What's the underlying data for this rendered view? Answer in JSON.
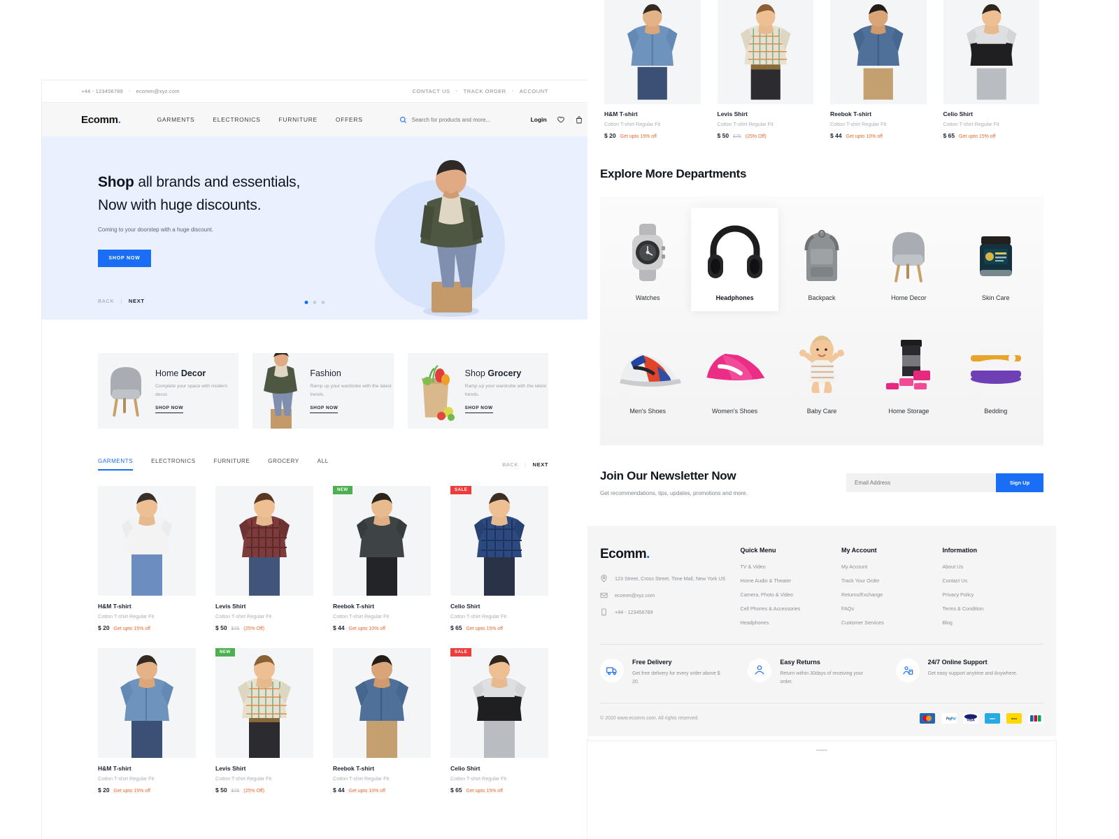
{
  "topbar": {
    "phone": "+44 - 123456789",
    "email": "ecomm@xyz.com",
    "links": [
      "CONTACT US",
      "TRACK ORDER",
      "ACCOUNT"
    ],
    "separator": "›"
  },
  "nav": {
    "brand": "Ecomm",
    "brand_dot": ".",
    "links": [
      "GARMENTS",
      "ELECTRONICS",
      "FURNITURE",
      "OFFERS"
    ],
    "search_placeholder": "Search for products and more...",
    "login": "Login",
    "accent": "#1a6ef5"
  },
  "hero": {
    "title_bold": "Shop",
    "title_rest": " all brands and essentials, Now with huge discounts.",
    "subtitle": "Coming to your doorstep with a huge discount.",
    "cta": "SHOP NOW",
    "back": "BACK",
    "divider": "|",
    "next": "NEXT",
    "slide_count": 3,
    "active_slide": 1
  },
  "category_cards": [
    {
      "title_pre": "Home ",
      "title_bold": "Decor",
      "desc": "Complete your space with modern decor.",
      "cta": "SHOP NOW",
      "icon": "chair-icon"
    },
    {
      "title_pre": "",
      "title_bold": "Fashion",
      "desc": "Ramp up your wardrobe with the latest trends.",
      "cta": "SHOP NOW",
      "icon": "fashion-model-icon"
    },
    {
      "title_pre": "Shop ",
      "title_bold": "Grocery",
      "desc": "Ramp up your wardrobe with the latest trends.",
      "cta": "SHOP NOW",
      "icon": "grocery-bag-icon"
    }
  ],
  "product_tabs": {
    "items": [
      "GARMENTS",
      "ELECTRONICS",
      "FURNITURE",
      "GROCERY",
      "ALL"
    ],
    "active": "GARMENTS",
    "back": "BACK",
    "divider": "|",
    "next": "NEXT"
  },
  "products_row1": [
    {
      "name": "H&M T-shirt",
      "desc": "Cotton T-shirt Regular Fit",
      "price": "$ 20",
      "old": "",
      "off": "Get upto 15% off",
      "badge": "",
      "badge_type": ""
    },
    {
      "name": "Levis Shirt",
      "desc": "Cotton T-shirt Regular Fit",
      "price": "$ 50",
      "old": "$75",
      "off": "(25% Off)",
      "badge": "",
      "badge_type": ""
    },
    {
      "name": "Reebok T-shirt",
      "desc": "Cotton T-shirt Regular Fit",
      "price": "$ 44",
      "old": "",
      "off": "Get upto 10% off",
      "badge": "NEW",
      "badge_type": "new"
    },
    {
      "name": "Celio Shirt",
      "desc": "Cotton T-shirt Regular Fit",
      "price": "$ 65",
      "old": "",
      "off": "Get upto 15% off",
      "badge": "SALE",
      "badge_type": "sale"
    }
  ],
  "products_row2": [
    {
      "name": "H&M T-shirt",
      "desc": "Cotton T-shirt Regular Fit",
      "price": "$ 20",
      "old": "",
      "off": "Get upto 15% off",
      "badge": "",
      "badge_type": ""
    },
    {
      "name": "Levis Shirt",
      "desc": "Cotton T-shirt Regular Fit",
      "price": "$ 50",
      "old": "$75",
      "off": "(25% Off)",
      "badge": "NEW",
      "badge_type": "new"
    },
    {
      "name": "Reebok T-shirt",
      "desc": "Cotton T-shirt Regular Fit",
      "price": "$ 44",
      "old": "",
      "off": "Get upto 10% off",
      "badge": "",
      "badge_type": ""
    },
    {
      "name": "Celio Shirt",
      "desc": "Cotton T-shirt Regular Fit",
      "price": "$ 65",
      "old": "",
      "off": "Get upto 15% off",
      "badge": "SALE",
      "badge_type": "sale"
    }
  ],
  "right_products": [
    {
      "name": "H&M T-shirt",
      "desc": "Cotton T-shirt Regular Fit",
      "price": "$ 20",
      "old": "",
      "off": "Get upto 15% off"
    },
    {
      "name": "Levis Shirt",
      "desc": "Cotton T-shirt Regular Fit",
      "price": "$ 50",
      "old": "$75",
      "off": "(25% Off)"
    },
    {
      "name": "Reebok T-shirt",
      "desc": "Cotton T-shirt Regular Fit",
      "price": "$ 44",
      "old": "",
      "off": "Get upto 10% off"
    },
    {
      "name": "Celio Shirt",
      "desc": "Cotton T-shirt Regular Fit",
      "price": "$ 65",
      "old": "",
      "off": "Get upto 15% off"
    }
  ],
  "departments": {
    "title": "Explore More Departments",
    "row1": [
      {
        "label": "Watches",
        "icon": "watch-icon",
        "highlight": false
      },
      {
        "label": "Headphones",
        "icon": "headphones-icon",
        "highlight": true
      },
      {
        "label": "Backpack",
        "icon": "backpack-icon",
        "highlight": false
      },
      {
        "label": "Home Decor",
        "icon": "armchair-icon",
        "highlight": false
      },
      {
        "label": "Skin Care",
        "icon": "cream-jar-icon",
        "highlight": false
      }
    ],
    "row2": [
      {
        "label": "Men's Shoes",
        "icon": "mens-shoe-icon",
        "highlight": false
      },
      {
        "label": "Women's Shoes",
        "icon": "womens-shoe-icon",
        "highlight": false
      },
      {
        "label": "Baby Care",
        "icon": "baby-icon",
        "highlight": false
      },
      {
        "label": "Home Storage",
        "icon": "storage-containers-icon",
        "highlight": false
      },
      {
        "label": "Bedding",
        "icon": "pillows-icon",
        "highlight": false
      }
    ]
  },
  "newsletter": {
    "title": "Join Our Newsletter Now",
    "subtitle": "Get recommendations, tips, updates, promotions and more.",
    "placeholder": "Email Address",
    "button": "Sign Up"
  },
  "footer": {
    "brand": "Ecomm",
    "brand_dot": ".",
    "address": "123 Street, Cross Street, Time Mall, New York US",
    "email": "ecomm@xyz.com",
    "phone": "+44 - 123456789",
    "columns": [
      {
        "title": "Quick Menu",
        "items": [
          "TV & Video",
          "Home Audio & Theater",
          "Camera, Photo & Video",
          "Cell Phones & Accessories",
          "Headphones"
        ]
      },
      {
        "title": "My Account",
        "items": [
          "My Account",
          "Track Your Order",
          "Returns/Exchange",
          "FAQs",
          "Customer Services"
        ]
      },
      {
        "title": "Information",
        "items": [
          "About Us",
          "Contact Us",
          "Privacy Policy",
          "Terms & Condition",
          "Blog"
        ]
      }
    ],
    "features": [
      {
        "title": "Free Delivery",
        "desc": "Get free delivery for every order above $ 20.",
        "icon": "delivery-truck-icon"
      },
      {
        "title": "Easy Returns",
        "desc": "Return within 30days of receiving your order.",
        "icon": "returns-hand-icon"
      },
      {
        "title": "24/7 Online Support",
        "desc": "Get easy support anytime and Anywhere.",
        "icon": "support-agent-icon"
      }
    ],
    "copyright": "© 2020 www.ecomm.com. All rights reserved.",
    "payments": [
      {
        "name": "mastercard-icon",
        "label": "MasterCard",
        "bg": "#2566af"
      },
      {
        "name": "paypal-icon",
        "label": "PayPal",
        "bg": "#ffffff"
      },
      {
        "name": "visa-icon",
        "label": "VISA",
        "bg": "#1a1f71"
      },
      {
        "name": "amex-icon",
        "label": "AMEX",
        "bg": "#27a9e1"
      },
      {
        "name": "maestro-icon",
        "label": "Maestro",
        "bg": "#ffd800"
      },
      {
        "name": "jcb-icon",
        "label": "JCB",
        "bg": "#ffffff"
      }
    ]
  }
}
